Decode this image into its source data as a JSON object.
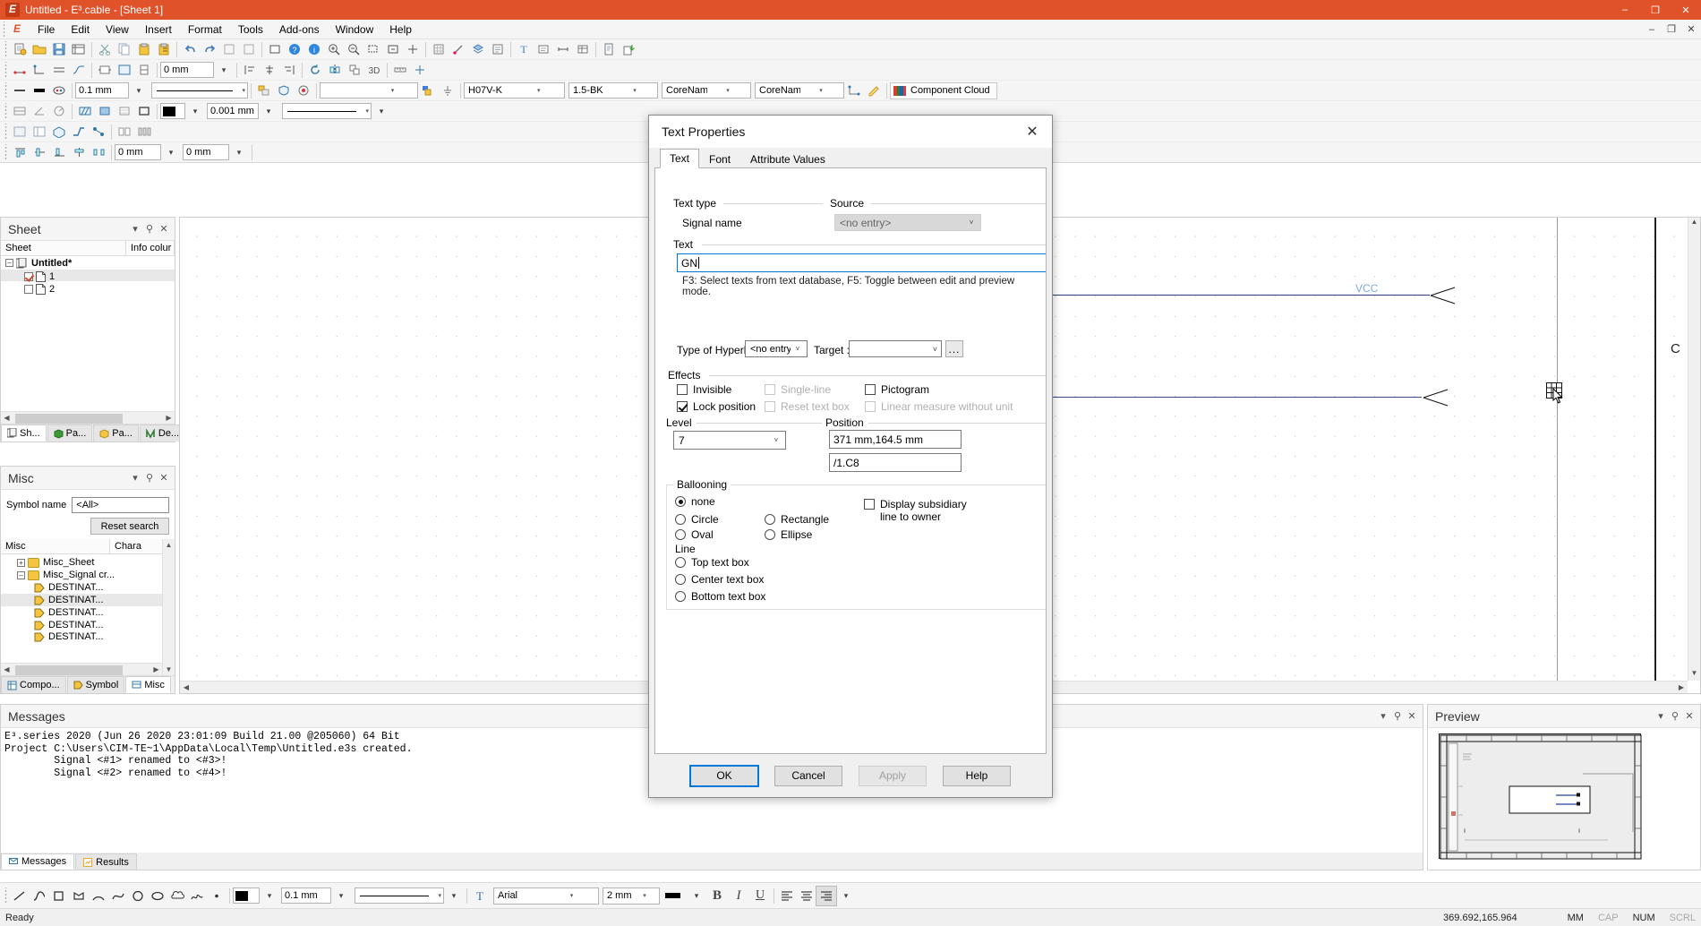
{
  "window": {
    "title": "Untitled - E³.cable - [Sheet 1]",
    "minimize": "–",
    "maximize": "❐",
    "close": "✕"
  },
  "menubar": {
    "items": [
      "File",
      "Edit",
      "View",
      "Insert",
      "Format",
      "Tools",
      "Add-ons",
      "Window",
      "Help"
    ],
    "doc_minimize": "–",
    "doc_restore": "❐",
    "doc_close": "✕"
  },
  "toolbars": {
    "row2": {
      "size_value": "0 mm"
    },
    "row3": {
      "line_width": "0.1 mm",
      "wire_type": "H07V-K",
      "wire_cross": "1.5-BK",
      "core_hori": "CoreName_hori",
      "core_vert": "CoreName_vert",
      "component_cloud": "Component Cloud"
    },
    "row4": {
      "dim_value": "0.001 mm"
    },
    "row6": {
      "x_value": "0 mm",
      "y_value": "0 mm"
    }
  },
  "sheet_panel": {
    "title": "Sheet",
    "col_name": "Sheet",
    "col_info": "Info colur",
    "root": "Untitled*",
    "rows": [
      {
        "label": "1",
        "checked": true,
        "selected": true
      },
      {
        "label": "2",
        "checked": false,
        "selected": false
      }
    ],
    "tabs": [
      {
        "label": "Sh...",
        "active": true
      },
      {
        "label": "Pa...",
        "active": false
      },
      {
        "label": "Pa...",
        "active": false
      },
      {
        "label": "De...",
        "active": false
      }
    ]
  },
  "misc_panel": {
    "title": "Misc",
    "symbol_name_label": "Symbol name",
    "symbol_name_value": "<All>",
    "reset_search": "Reset search",
    "col_name": "Misc",
    "col_chara": "Chara",
    "rows": [
      {
        "label": "Misc_Sheet",
        "type": "folder",
        "expanded": false,
        "indent": 1,
        "selected": false
      },
      {
        "label": "Misc_Signal cr...",
        "type": "folder",
        "expanded": true,
        "indent": 1,
        "selected": false
      },
      {
        "label": "DESTINAT...",
        "type": "symbol",
        "indent": 2,
        "selected": false
      },
      {
        "label": "DESTINAT...",
        "type": "symbol",
        "indent": 2,
        "selected": true
      },
      {
        "label": "DESTINAT...",
        "type": "symbol",
        "indent": 2,
        "selected": false
      },
      {
        "label": "DESTINAT...",
        "type": "symbol",
        "indent": 2,
        "selected": false
      },
      {
        "label": "DESTINAT...",
        "type": "symbol",
        "indent": 2,
        "selected": false
      }
    ],
    "tabs": [
      {
        "label": "Compo...",
        "active": false
      },
      {
        "label": "Symbol",
        "active": false
      },
      {
        "label": "Misc",
        "active": true
      }
    ]
  },
  "canvas": {
    "vcc_label": "VCC",
    "c_letter": "C"
  },
  "messages_panel": {
    "title": "Messages",
    "log": "E³.series 2020 (Jun 26 2020 23:01:09 Build 21.00 @205060) 64 Bit\nProject C:\\Users\\CIM-TE~1\\AppData\\Local\\Temp\\Untitled.e3s created.\n        Signal <#1> renamed to <#3>!\n        Signal <#2> renamed to <#4>!",
    "tabs": [
      {
        "label": "Messages",
        "active": true
      },
      {
        "label": "Results",
        "active": false
      }
    ]
  },
  "preview_panel": {
    "title": "Preview"
  },
  "bottom_toolbar": {
    "line_width": "0.1 mm",
    "font_name": "Arial",
    "font_size": "2 mm",
    "bold": "B",
    "italic": "I",
    "underline": "U"
  },
  "statusbar": {
    "status": "Ready",
    "coords": "369.692,165.964",
    "units": "MM",
    "caps": "CAP",
    "num": "NUM",
    "scroll": "SCRL"
  },
  "dialog": {
    "title": "Text Properties",
    "close": "✕",
    "tabs": [
      {
        "label": "Text",
        "active": true
      },
      {
        "label": "Font",
        "active": false
      },
      {
        "label": "Attribute Values",
        "active": false
      }
    ],
    "text_type": {
      "group_label": "Text type",
      "signal_name_label": "Signal name"
    },
    "source": {
      "group_label": "Source",
      "value": "<no entry>"
    },
    "text": {
      "group_label": "Text",
      "value": "GN",
      "placeholder": "",
      "hint": "F3: Select texts from text database, F5: Toggle between edit and preview mode."
    },
    "hyperlink": {
      "type_label": "Type of Hyperlink :",
      "type_value": "<no entry>",
      "target_label": "Target :",
      "target_value": "",
      "browse_label": "..."
    },
    "effects": {
      "group_label": "Effects",
      "items": [
        {
          "label": "Invisible",
          "checked": false,
          "disabled": false
        },
        {
          "label": "Single-line",
          "checked": false,
          "disabled": true
        },
        {
          "label": "Pictogram",
          "checked": false,
          "disabled": false
        },
        {
          "label": "Lock position",
          "checked": true,
          "disabled": false
        },
        {
          "label": "Reset text box",
          "checked": false,
          "disabled": true
        },
        {
          "label": "Linear measure without unit",
          "checked": false,
          "disabled": true
        }
      ]
    },
    "level": {
      "group_label": "Level",
      "value": "7"
    },
    "position": {
      "group_label": "Position",
      "coords": "371 mm,164.5 mm",
      "path": "/1.C8"
    },
    "ballooning": {
      "group_label": "Ballooning",
      "options": [
        {
          "label": "none",
          "selected": true
        },
        {
          "label": "Circle",
          "selected": false
        },
        {
          "label": "Rectangle",
          "selected": false
        },
        {
          "label": "Oval",
          "selected": false
        },
        {
          "label": "Ellipse",
          "selected": false
        }
      ],
      "subsidiary_label": "Display subsidiary line to owner",
      "subsidiary_checked": false,
      "line_group_label": "Line",
      "line_options": [
        {
          "label": "Top text box",
          "selected": false
        },
        {
          "label": "Center text box",
          "selected": false
        },
        {
          "label": "Bottom text box",
          "selected": false
        }
      ]
    },
    "buttons": {
      "ok": "OK",
      "cancel": "Cancel",
      "apply": "Apply",
      "help": "Help"
    }
  },
  "colors": {
    "title_bar": "#E0522A",
    "accent": "#0078d7",
    "signal": "#2b3a80",
    "vcc_text": "#7FA8D8"
  }
}
